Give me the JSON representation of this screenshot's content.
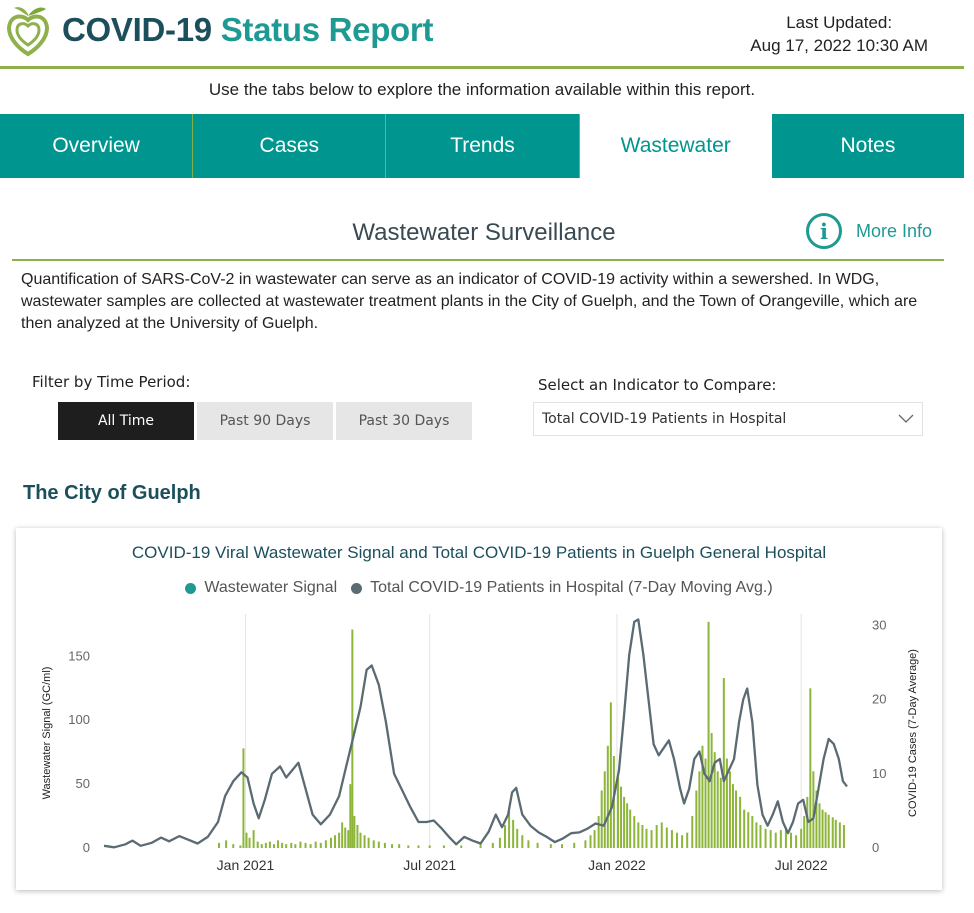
{
  "header": {
    "title_main": "COVID-19",
    "title_accent": "Status Report",
    "updated_label": "Last Updated:",
    "updated_value": "Aug 17, 2022 10:30 AM",
    "logo_icon": "apple-heart-icon"
  },
  "hint": "Use the tabs below to explore the information available within this report.",
  "tabs": [
    {
      "label": "Overview",
      "active": false
    },
    {
      "label": "Cases",
      "active": false
    },
    {
      "label": "Trends",
      "active": false
    },
    {
      "label": "Wastewater",
      "active": true
    },
    {
      "label": "Notes",
      "active": false
    }
  ],
  "section": {
    "title": "Wastewater Surveillance",
    "more_info": "More Info",
    "description": "Quantification of SARS-CoV-2 in wastewater can serve as an indicator of COVID-19 activity within a sewershed. In WDG, wastewater samples are collected at wastewater treatment plants in the City of Guelph, and the Town of Orangeville, which are then analyzed at the University of Guelph."
  },
  "filters": {
    "time_label": "Filter by Time Period:",
    "time_options": [
      "All Time",
      "Past 90 Days",
      "Past 30 Days"
    ],
    "time_selected": "All Time",
    "indicator_label": "Select an Indicator to Compare:",
    "indicator_value": "Total COVID-19 Patients in Hospital"
  },
  "city_title": "The City of Guelph",
  "colors": {
    "teal": "#00958f",
    "olive": "#8fb04a",
    "bar": "#8cb53a",
    "line": "#5a6b73"
  },
  "chart_data": {
    "type": "bar",
    "title": "COVID-19 Viral Wastewater Signal and Total COVID-19 Patients in Guelph General Hospital",
    "ylabel": "Wastewater Signal (GC/ml)",
    "y2label": "COVID-19 Cases (7-Day Average)",
    "ylim": [
      0,
      180
    ],
    "y2lim": [
      0,
      31
    ],
    "yticks": [
      0,
      50,
      100,
      150
    ],
    "y2ticks": [
      0,
      10,
      20,
      30
    ],
    "xlim": [
      "2020-08-15",
      "2022-08-16"
    ],
    "xticks": [
      {
        "label": "Jan 2021",
        "date": "2021-01-01"
      },
      {
        "label": "Jul 2021",
        "date": "2021-07-01"
      },
      {
        "label": "Jan 2022",
        "date": "2022-01-01"
      },
      {
        "label": "Jul 2022",
        "date": "2022-07-01"
      }
    ],
    "legend": "top",
    "series": [
      {
        "name": "Wastewater Signal",
        "type": "bar",
        "color": "#8cb53a",
        "points": [
          [
            "2020-12-06",
            4
          ],
          [
            "2020-12-13",
            6
          ],
          [
            "2020-12-20",
            3
          ],
          [
            "2020-12-27",
            2
          ],
          [
            "2020-12-30",
            78
          ],
          [
            "2021-01-02",
            12
          ],
          [
            "2021-01-05",
            8
          ],
          [
            "2021-01-09",
            14
          ],
          [
            "2021-01-13",
            5
          ],
          [
            "2021-01-17",
            3
          ],
          [
            "2021-01-21",
            4
          ],
          [
            "2021-01-25",
            5
          ],
          [
            "2021-01-29",
            3
          ],
          [
            "2021-02-02",
            6
          ],
          [
            "2021-02-06",
            4
          ],
          [
            "2021-02-10",
            3
          ],
          [
            "2021-02-15",
            4
          ],
          [
            "2021-02-19",
            3
          ],
          [
            "2021-02-24",
            5
          ],
          [
            "2021-03-01",
            4
          ],
          [
            "2021-03-06",
            3
          ],
          [
            "2021-03-11",
            5
          ],
          [
            "2021-03-16",
            4
          ],
          [
            "2021-03-21",
            6
          ],
          [
            "2021-03-26",
            8
          ],
          [
            "2021-03-30",
            10
          ],
          [
            "2021-04-03",
            12
          ],
          [
            "2021-04-06",
            20
          ],
          [
            "2021-04-09",
            16
          ],
          [
            "2021-04-12",
            14
          ],
          [
            "2021-04-14",
            50
          ],
          [
            "2021-04-16",
            171
          ],
          [
            "2021-04-18",
            25
          ],
          [
            "2021-04-21",
            18
          ],
          [
            "2021-04-24",
            12
          ],
          [
            "2021-04-28",
            10
          ],
          [
            "2021-05-02",
            8
          ],
          [
            "2021-05-07",
            6
          ],
          [
            "2021-05-12",
            5
          ],
          [
            "2021-05-18",
            4
          ],
          [
            "2021-05-25",
            3
          ],
          [
            "2021-06-01",
            3
          ],
          [
            "2021-06-10",
            2
          ],
          [
            "2021-06-20",
            2
          ],
          [
            "2021-07-01",
            2
          ],
          [
            "2021-07-15",
            2
          ],
          [
            "2021-08-01",
            2
          ],
          [
            "2021-08-20",
            3
          ],
          [
            "2021-09-01",
            4
          ],
          [
            "2021-09-08",
            8
          ],
          [
            "2021-09-13",
            18
          ],
          [
            "2021-09-17",
            30
          ],
          [
            "2021-09-21",
            22
          ],
          [
            "2021-09-25",
            15
          ],
          [
            "2021-09-30",
            10
          ],
          [
            "2021-10-06",
            6
          ],
          [
            "2021-10-15",
            4
          ],
          [
            "2021-10-28",
            3
          ],
          [
            "2021-11-08",
            3
          ],
          [
            "2021-11-20",
            4
          ],
          [
            "2021-12-01",
            6
          ],
          [
            "2021-12-06",
            10
          ],
          [
            "2021-12-10",
            14
          ],
          [
            "2021-12-14",
            25
          ],
          [
            "2021-12-17",
            45
          ],
          [
            "2021-12-20",
            60
          ],
          [
            "2021-12-23",
            80
          ],
          [
            "2021-12-26",
            114
          ],
          [
            "2021-12-29",
            72
          ],
          [
            "2022-01-02",
            55
          ],
          [
            "2022-01-05",
            48
          ],
          [
            "2022-01-08",
            40
          ],
          [
            "2022-01-11",
            35
          ],
          [
            "2022-01-14",
            30
          ],
          [
            "2022-01-18",
            25
          ],
          [
            "2022-01-22",
            20
          ],
          [
            "2022-01-26",
            18
          ],
          [
            "2022-01-30",
            15
          ],
          [
            "2022-02-04",
            14
          ],
          [
            "2022-02-09",
            18
          ],
          [
            "2022-02-14",
            20
          ],
          [
            "2022-02-19",
            16
          ],
          [
            "2022-02-24",
            14
          ],
          [
            "2022-03-01",
            12
          ],
          [
            "2022-03-06",
            10
          ],
          [
            "2022-03-11",
            12
          ],
          [
            "2022-03-16",
            25
          ],
          [
            "2022-03-20",
            45
          ],
          [
            "2022-03-23",
            60
          ],
          [
            "2022-03-26",
            80
          ],
          [
            "2022-03-29",
            70
          ],
          [
            "2022-04-01",
            177
          ],
          [
            "2022-04-04",
            90
          ],
          [
            "2022-04-07",
            75
          ],
          [
            "2022-04-10",
            60
          ],
          [
            "2022-04-13",
            55
          ],
          [
            "2022-04-16",
            133
          ],
          [
            "2022-04-19",
            70
          ],
          [
            "2022-04-22",
            60
          ],
          [
            "2022-04-25",
            50
          ],
          [
            "2022-04-28",
            45
          ],
          [
            "2022-05-02",
            40
          ],
          [
            "2022-05-06",
            30
          ],
          [
            "2022-05-10",
            28
          ],
          [
            "2022-05-14",
            25
          ],
          [
            "2022-05-18",
            20
          ],
          [
            "2022-05-22",
            18
          ],
          [
            "2022-05-27",
            15
          ],
          [
            "2022-06-01",
            14
          ],
          [
            "2022-06-06",
            12
          ],
          [
            "2022-06-11",
            14
          ],
          [
            "2022-06-16",
            16
          ],
          [
            "2022-06-21",
            12
          ],
          [
            "2022-06-26",
            10
          ],
          [
            "2022-07-01",
            15
          ],
          [
            "2022-07-04",
            25
          ],
          [
            "2022-07-07",
            40
          ],
          [
            "2022-07-10",
            125
          ],
          [
            "2022-07-13",
            60
          ],
          [
            "2022-07-16",
            45
          ],
          [
            "2022-07-19",
            35
          ],
          [
            "2022-07-22",
            30
          ],
          [
            "2022-07-25",
            28
          ],
          [
            "2022-07-28",
            26
          ],
          [
            "2022-08-01",
            24
          ],
          [
            "2022-08-04",
            22
          ],
          [
            "2022-08-08",
            20
          ],
          [
            "2022-08-12",
            18
          ]
        ]
      },
      {
        "name": "Total COVID-19 Patients in Hospital (7-Day Moving Avg.)",
        "type": "line",
        "axis": "y2",
        "color": "#5a6b73",
        "points": [
          [
            "2020-08-15",
            0.3
          ],
          [
            "2020-08-25",
            0.1
          ],
          [
            "2020-09-05",
            0.5
          ],
          [
            "2020-09-12",
            1.0
          ],
          [
            "2020-09-20",
            0.3
          ],
          [
            "2020-10-01",
            0.7
          ],
          [
            "2020-10-10",
            1.4
          ],
          [
            "2020-10-18",
            0.9
          ],
          [
            "2020-10-28",
            1.6
          ],
          [
            "2020-11-06",
            1.1
          ],
          [
            "2020-11-15",
            0.6
          ],
          [
            "2020-11-25",
            1.5
          ],
          [
            "2020-12-05",
            3.5
          ],
          [
            "2020-12-12",
            7.0
          ],
          [
            "2020-12-20",
            9.0
          ],
          [
            "2020-12-28",
            10.2
          ],
          [
            "2021-01-03",
            9.5
          ],
          [
            "2021-01-09",
            6.0
          ],
          [
            "2021-01-14",
            4.0
          ],
          [
            "2021-01-20",
            6.5
          ],
          [
            "2021-01-27",
            10.0
          ],
          [
            "2021-02-04",
            11.0
          ],
          [
            "2021-02-10",
            9.5
          ],
          [
            "2021-02-16",
            10.5
          ],
          [
            "2021-02-22",
            11.5
          ],
          [
            "2021-03-01",
            8.0
          ],
          [
            "2021-03-08",
            4.5
          ],
          [
            "2021-03-16",
            3.2
          ],
          [
            "2021-03-25",
            4.5
          ],
          [
            "2021-04-03",
            7.0
          ],
          [
            "2021-04-10",
            11.0
          ],
          [
            "2021-04-17",
            15.0
          ],
          [
            "2021-04-24",
            19.0
          ],
          [
            "2021-04-30",
            24.0
          ],
          [
            "2021-05-05",
            24.6
          ],
          [
            "2021-05-12",
            22.0
          ],
          [
            "2021-05-19",
            17.0
          ],
          [
            "2021-05-27",
            10.0
          ],
          [
            "2021-06-05",
            7.5
          ],
          [
            "2021-06-12",
            5.5
          ],
          [
            "2021-06-20",
            3.5
          ],
          [
            "2021-06-28",
            3.5
          ],
          [
            "2021-07-05",
            3.7
          ],
          [
            "2021-07-13",
            2.6
          ],
          [
            "2021-07-20",
            1.5
          ],
          [
            "2021-07-27",
            0.5
          ],
          [
            "2021-08-04",
            1.5
          ],
          [
            "2021-08-12",
            1.0
          ],
          [
            "2021-08-20",
            0.6
          ],
          [
            "2021-08-28",
            2.2
          ],
          [
            "2021-09-04",
            4.5
          ],
          [
            "2021-09-10",
            2.8
          ],
          [
            "2021-09-16",
            4.5
          ],
          [
            "2021-09-20",
            7.5
          ],
          [
            "2021-09-24",
            8.1
          ],
          [
            "2021-09-30",
            4.5
          ],
          [
            "2021-10-08",
            3.0
          ],
          [
            "2021-10-16",
            2.1
          ],
          [
            "2021-10-24",
            1.5
          ],
          [
            "2021-11-01",
            0.8
          ],
          [
            "2021-11-09",
            1.3
          ],
          [
            "2021-11-17",
            2.0
          ],
          [
            "2021-11-25",
            2.1
          ],
          [
            "2021-12-03",
            2.6
          ],
          [
            "2021-12-11",
            3.3
          ],
          [
            "2021-12-19",
            3.0
          ],
          [
            "2021-12-27",
            5.5
          ],
          [
            "2022-01-03",
            10.5
          ],
          [
            "2022-01-08",
            18.0
          ],
          [
            "2022-01-13",
            26.0
          ],
          [
            "2022-01-18",
            30.5
          ],
          [
            "2022-01-22",
            30.8
          ],
          [
            "2022-01-27",
            26.0
          ],
          [
            "2022-02-01",
            20.0
          ],
          [
            "2022-02-06",
            14.0
          ],
          [
            "2022-02-11",
            12.5
          ],
          [
            "2022-02-16",
            13.5
          ],
          [
            "2022-02-21",
            14.5
          ],
          [
            "2022-02-26",
            12.0
          ],
          [
            "2022-03-04",
            8.0
          ],
          [
            "2022-03-08",
            6.0
          ],
          [
            "2022-03-13",
            8.0
          ],
          [
            "2022-03-18",
            12.0
          ],
          [
            "2022-03-23",
            13.0
          ],
          [
            "2022-03-28",
            10.0
          ],
          [
            "2022-04-02",
            9.0
          ],
          [
            "2022-04-07",
            11.5
          ],
          [
            "2022-04-12",
            12.0
          ],
          [
            "2022-04-16",
            9.0
          ],
          [
            "2022-04-21",
            10.5
          ],
          [
            "2022-04-26",
            12.0
          ],
          [
            "2022-05-01",
            17.0
          ],
          [
            "2022-05-05",
            20.0
          ],
          [
            "2022-05-09",
            21.5
          ],
          [
            "2022-05-14",
            17.0
          ],
          [
            "2022-05-19",
            8.5
          ],
          [
            "2022-05-24",
            4.5
          ],
          [
            "2022-05-29",
            3.0
          ],
          [
            "2022-06-03",
            4.5
          ],
          [
            "2022-06-08",
            6.3
          ],
          [
            "2022-06-13",
            3.5
          ],
          [
            "2022-06-18",
            2.0
          ],
          [
            "2022-06-23",
            3.5
          ],
          [
            "2022-06-28",
            6.0
          ],
          [
            "2022-07-03",
            6.5
          ],
          [
            "2022-07-08",
            3.5
          ],
          [
            "2022-07-13",
            4.0
          ],
          [
            "2022-07-18",
            8.0
          ],
          [
            "2022-07-23",
            12.0
          ],
          [
            "2022-07-28",
            14.7
          ],
          [
            "2022-08-02",
            14.0
          ],
          [
            "2022-08-07",
            12.0
          ],
          [
            "2022-08-11",
            9.0
          ],
          [
            "2022-08-15",
            8.3
          ]
        ]
      }
    ]
  }
}
